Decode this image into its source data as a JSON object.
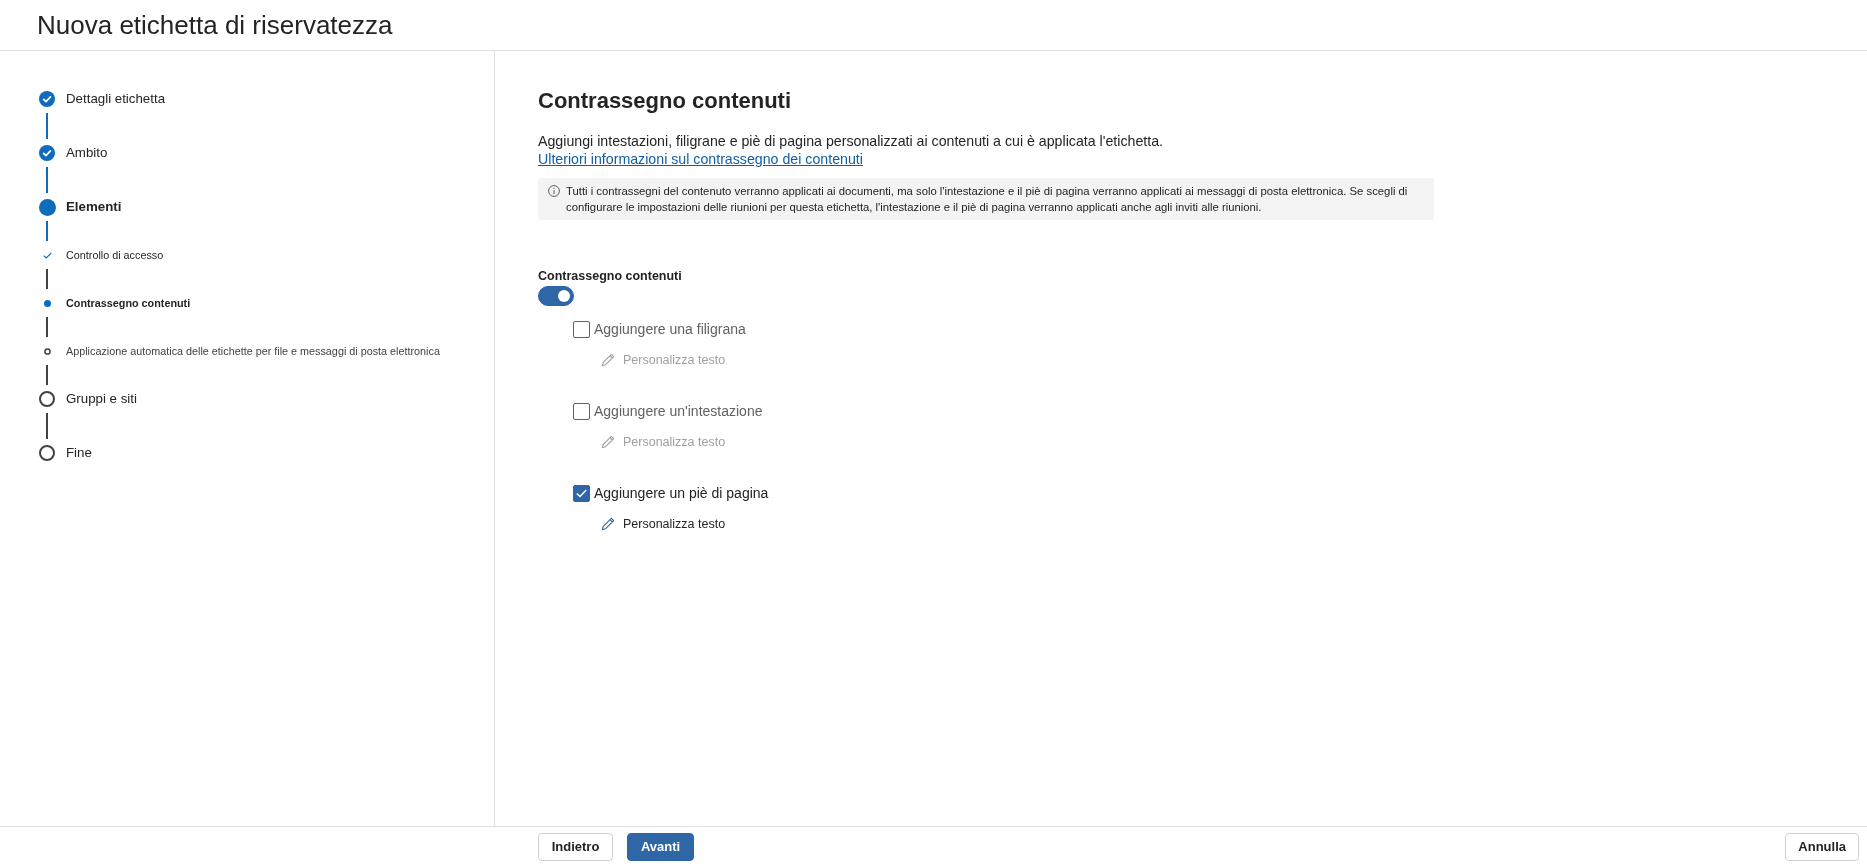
{
  "window": {
    "title": "Nuova etichetta di riservatezza"
  },
  "steps": [
    {
      "label": "Dettagli etichetta",
      "completed": true,
      "current": false
    },
    {
      "label": "Ambito",
      "completed": true,
      "current": false
    },
    {
      "label": "Elementi",
      "completed": false,
      "current": true,
      "children": [
        {
          "label": "Controllo di accesso",
          "completed": true,
          "current": false
        },
        {
          "label": "Contrassegno contenuti",
          "completed": false,
          "current": true
        },
        {
          "label": "Applicazione automatica delle etichette per file e messaggi di posta elettronica",
          "completed": false,
          "current": false
        }
      ]
    },
    {
      "label": "Gruppi e siti",
      "completed": false,
      "current": false
    },
    {
      "label": "Fine",
      "completed": false,
      "current": false
    }
  ],
  "page": {
    "heading": "Contrassegno contenuti",
    "description": "Aggiungi intestazioni, filigrane e piè di pagina personalizzati ai contenuti a cui è applicata l'etichetta.",
    "link": "Ulteriori informazioni sul contrassegno dei contenuti",
    "info": "Tutti i contrassegni del contenuto verranno applicati ai documenti, ma solo l'intestazione e il piè di pagina verranno applicati ai messaggi di posta elettronica. Se scegli di configurare le impostazioni delle riunioni per questa etichetta, l'intestazione e il piè di pagina verranno applicati anche agli inviti alle riunioni."
  },
  "content_marking": {
    "label": "Contrassegno contenuti",
    "on": true,
    "options": [
      {
        "label": "Aggiungere una filigrana",
        "checked": false,
        "customize": {
          "label": "Personalizza testo",
          "disabled": true
        }
      },
      {
        "label": "Aggiungere un'intestazione",
        "checked": false,
        "customize": {
          "label": "Personalizza testo",
          "disabled": true
        }
      },
      {
        "label": "Aggiungere un piè di pagina",
        "checked": true,
        "customize": {
          "label": "Personalizza testo",
          "disabled": false
        }
      }
    ]
  },
  "footer": {
    "back": "Indietro",
    "next": "Avanti",
    "cancel": "Annulla"
  }
}
